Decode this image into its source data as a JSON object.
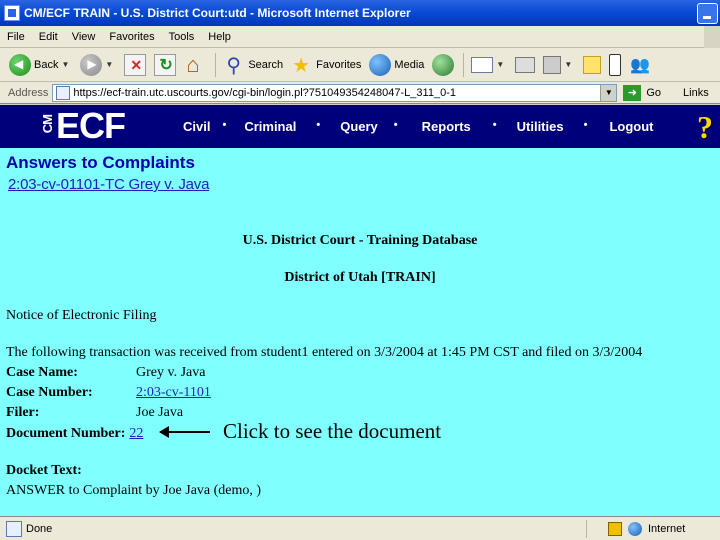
{
  "window": {
    "title": "CM/ECF TRAIN - U.S. District Court:utd - Microsoft Internet Explorer"
  },
  "menu": [
    "File",
    "Edit",
    "View",
    "Favorites",
    "Tools",
    "Help"
  ],
  "toolbar": {
    "back_label": "Back",
    "search_label": "Search",
    "favorites_label": "Favorites",
    "media_label": "Media"
  },
  "address": {
    "label": "Address",
    "url": "https://ecf-train.utc.uscourts.gov/cgi-bin/login.pl?751049354248047-L_311_0-1",
    "go_label": "Go",
    "links_label": "Links"
  },
  "ecf": {
    "logo_cm": "CM",
    "logo_ecf": "ECF",
    "nav": [
      "Civil",
      "Criminal",
      "Query",
      "Reports",
      "Utilities",
      "Logout"
    ],
    "nav_separator": "•",
    "help_glyph": "?"
  },
  "page": {
    "heading": "Answers to Complaints",
    "case_link": "2:03-cv-01101-TC Grey v. Java",
    "court_name": "U.S. District Court - Training Database",
    "district": "District of Utah [TRAIN]",
    "notice": "Notice of Electronic Filing",
    "transaction": "The following transaction was received from student1 entered on 3/3/2004 at 1:45 PM CST and filed on 3/3/2004",
    "case_name_label": "Case Name:",
    "case_name": "Grey v. Java",
    "case_number_label": "Case Number:",
    "case_number": "2:03-cv-1101",
    "filer_label": "Filer:",
    "filer": "Joe Java",
    "document_number_label": "Document Number:",
    "document_number": "22",
    "callout": "Click to see the document",
    "docket_label": "Docket Text:",
    "docket_text": "ANSWER to Complaint by Joe Java (demo, )"
  },
  "status": {
    "text": "Done",
    "zone": "Internet"
  }
}
